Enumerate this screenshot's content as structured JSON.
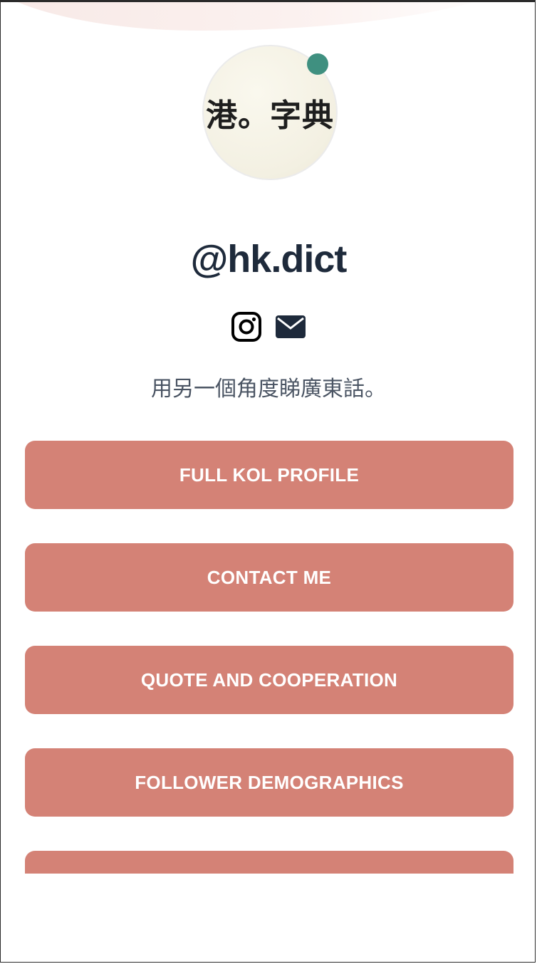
{
  "profile": {
    "avatar_text": "港。字典",
    "username": "@hk.dict",
    "bio": "用另一個角度睇廣東話。",
    "status_color": "#3f9080"
  },
  "social": [
    {
      "icon": "instagram-icon"
    },
    {
      "icon": "envelope-icon"
    }
  ],
  "buttons": [
    {
      "label": "FULL KOL PROFILE"
    },
    {
      "label": "CONTACT ME"
    },
    {
      "label": "QUOTE AND COOPERATION"
    },
    {
      "label": "FOLLOWER DEMOGRAPHICS"
    }
  ],
  "colors": {
    "button": "#d48276",
    "username": "#1e2a3b",
    "bio": "#4a5463"
  }
}
